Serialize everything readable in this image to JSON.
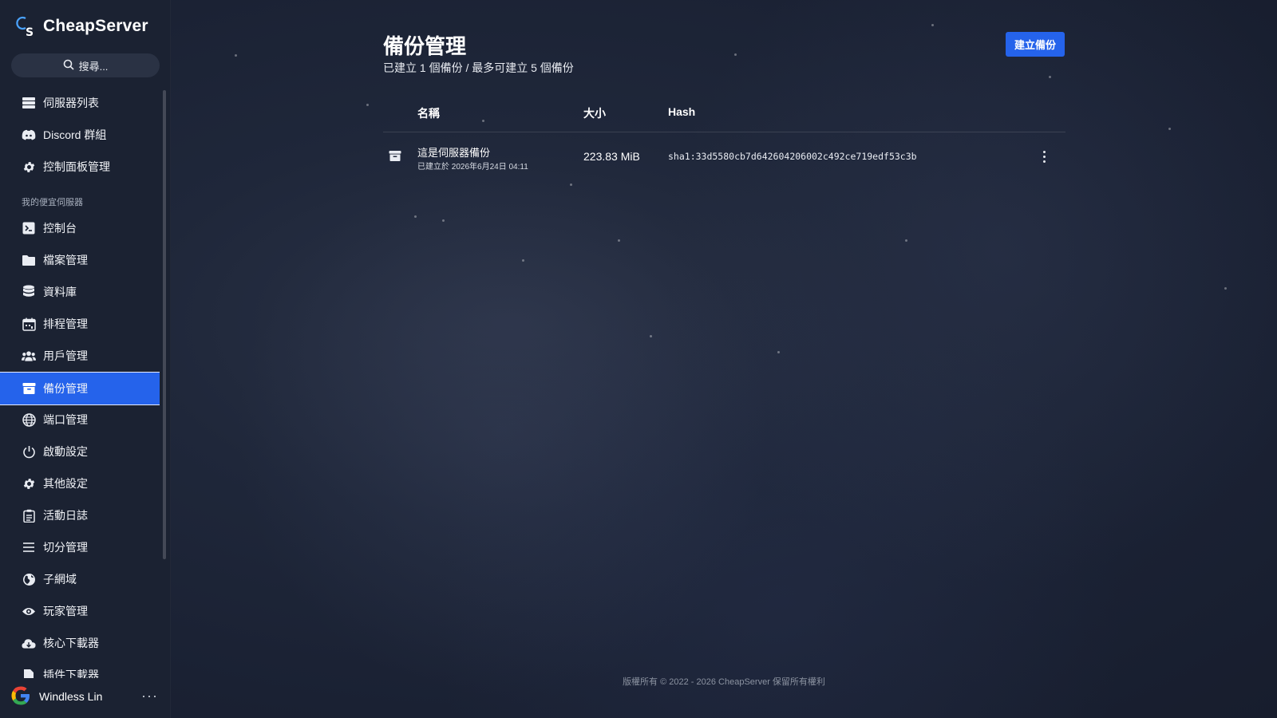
{
  "brand": {
    "name": "CheapServer"
  },
  "search": {
    "placeholder": "搜尋..."
  },
  "sidebar": {
    "top_items": [
      {
        "label": "伺服器列表",
        "icon": "server-list-icon"
      },
      {
        "label": "Discord 群組",
        "icon": "discord-icon"
      },
      {
        "label": "控制面板管理",
        "icon": "gear-icon"
      }
    ],
    "section_title": "我的便宜伺服器",
    "server_items": [
      {
        "label": "控制台",
        "icon": "terminal-icon"
      },
      {
        "label": "檔案管理",
        "icon": "folder-icon"
      },
      {
        "label": "資料庫",
        "icon": "database-icon"
      },
      {
        "label": "排程管理",
        "icon": "calendar-icon"
      },
      {
        "label": "用戶管理",
        "icon": "users-icon"
      },
      {
        "label": "備份管理",
        "icon": "archive-icon",
        "active": true
      },
      {
        "label": "端口管理",
        "icon": "globe-icon"
      },
      {
        "label": "啟動設定",
        "icon": "power-icon"
      },
      {
        "label": "其他設定",
        "icon": "gear-icon"
      },
      {
        "label": "活動日誌",
        "icon": "clipboard-icon"
      },
      {
        "label": "切分管理",
        "icon": "list-icon"
      },
      {
        "label": "子網域",
        "icon": "globe-americas-icon"
      },
      {
        "label": "玩家管理",
        "icon": "eye-icon"
      },
      {
        "label": "核心下載器",
        "icon": "cloud-download-icon"
      },
      {
        "label": "插件下載器",
        "icon": "file-icon"
      }
    ]
  },
  "user": {
    "name": "Windless Lin",
    "more": "···"
  },
  "page": {
    "title": "備份管理",
    "subtitle": "已建立 1 個備份 / 最多可建立 5 個備份",
    "create_button": "建立備份"
  },
  "table": {
    "headers": {
      "name": "名稱",
      "size": "大小",
      "hash": "Hash"
    },
    "rows": [
      {
        "name": "這是伺服器備份",
        "created": "已建立於 2026年6月24日 04:11",
        "size": "223.83 MiB",
        "hash": "sha1:33d5580cb7d642604206002c492ce719edf53c3b"
      }
    ]
  },
  "footer": {
    "text": "版權所有 © 2022 - 2026 CheapServer 保留所有權利"
  },
  "colors": {
    "accent": "#2563eb",
    "sidebar_bg": "#1b2232",
    "page_bg": "#1f273a"
  }
}
